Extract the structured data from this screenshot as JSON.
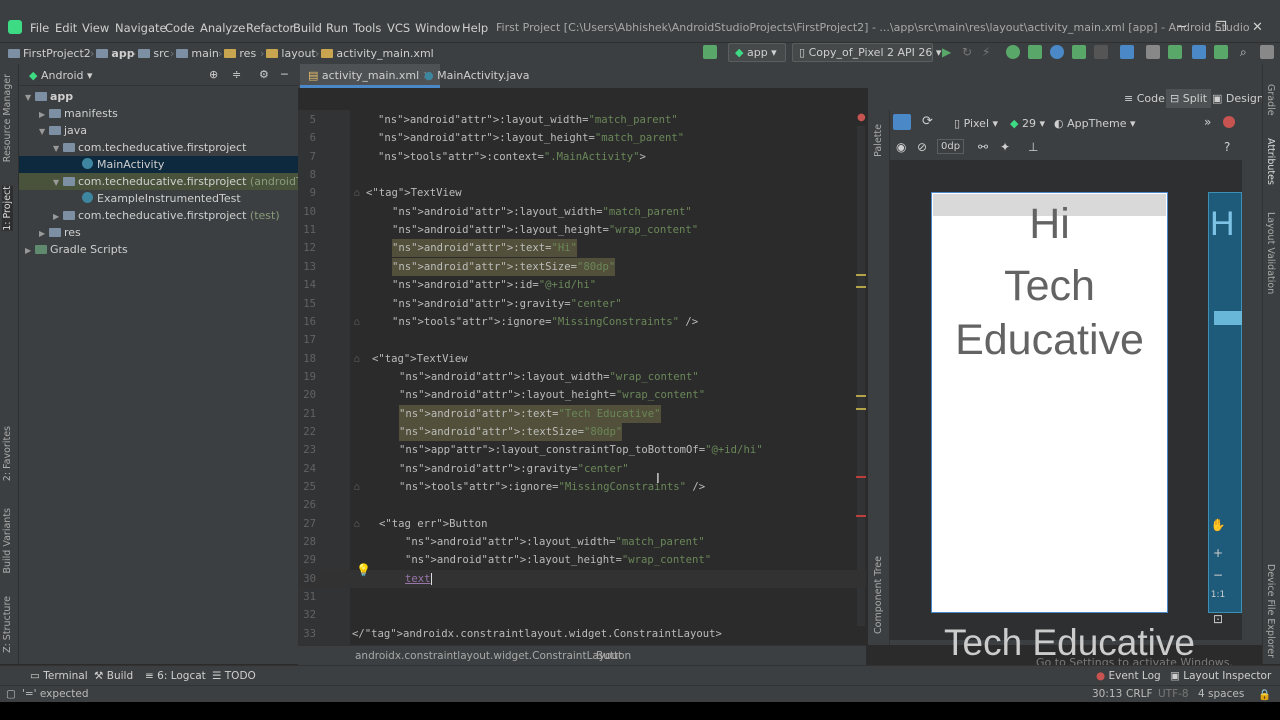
{
  "menu": [
    "File",
    "Edit",
    "View",
    "Navigate",
    "Code",
    "Analyze",
    "Refactor",
    "Build",
    "Run",
    "Tools",
    "VCS",
    "Window",
    "Help"
  ],
  "window_title": "First Project [C:\\Users\\Abhishek\\AndroidStudioProjects\\FirstProject2] - ...\\app\\src\\main\\res\\layout\\activity_main.xml [app] - Android Studio",
  "breadcrumbs": [
    "FirstProject2",
    "app",
    "src",
    "main",
    "res",
    "layout",
    "activity_main.xml"
  ],
  "toolbar": {
    "run_config": "app",
    "device": "Copy_of_Pixel 2 API 26"
  },
  "left_strip": [
    "Resource Manager",
    "1: Project",
    "2: Favorites",
    "Build Variants",
    "Z: Structure"
  ],
  "project": {
    "view_mode": "Android",
    "tree": [
      "app",
      "manifests",
      "java",
      "com.techeducative.firstproject",
      "MainActivity",
      "com.techeducative.firstproject",
      "(androidTest)",
      "ExampleInstrumentedTest",
      "com.techeducative.firstproject",
      "(test)",
      "res",
      "Gradle Scripts"
    ]
  },
  "tabs": [
    "activity_main.xml",
    "MainActivity.java"
  ],
  "view_modes": [
    "Code",
    "Split",
    "Design"
  ],
  "design_toolbar": {
    "device": "Pixel",
    "api": "29",
    "theme": "AppTheme",
    "margin": "0dp"
  },
  "palette_label": "Palette",
  "component_tree_label": "Component Tree",
  "right_strip": [
    "Gradle",
    "Attributes",
    "Layout Validation",
    "Device File Explorer"
  ],
  "code_lines": [
    {
      "n": "5",
      "t": "    android:layout_width=\"match_parent\""
    },
    {
      "n": "6",
      "t": "    android:layout_height=\"match_parent\""
    },
    {
      "n": "7",
      "t": "    tools:context=\".MainActivity\">"
    },
    {
      "n": "8",
      "t": ""
    },
    {
      "n": "9",
      "t": "<TextView"
    },
    {
      "n": "10",
      "t": "    android:layout_width=\"match_parent\""
    },
    {
      "n": "11",
      "t": "    android:layout_height=\"wrap_content\""
    },
    {
      "n": "12",
      "t": "    android:text=\"Hi\""
    },
    {
      "n": "13",
      "t": "    android:textSize=\"80dp\""
    },
    {
      "n": "14",
      "t": "    android:id=\"@+id/hi\""
    },
    {
      "n": "15",
      "t": "    android:gravity=\"center\""
    },
    {
      "n": "16",
      "t": "    tools:ignore=\"MissingConstraints\" />"
    },
    {
      "n": "17",
      "t": ""
    },
    {
      "n": "18",
      "t": "<TextView"
    },
    {
      "n": "19",
      "t": "    android:layout_width=\"wrap_content\""
    },
    {
      "n": "20",
      "t": "    android:layout_height=\"wrap_content\""
    },
    {
      "n": "21",
      "t": "    android:text=\"Tech Educative\""
    },
    {
      "n": "22",
      "t": "    android:textSize=\"80dp\""
    },
    {
      "n": "23",
      "t": "    app:layout_constraintTop_toBottomOf=\"@+id/hi\""
    },
    {
      "n": "24",
      "t": "    android:gravity=\"center\""
    },
    {
      "n": "25",
      "t": "    tools:ignore=\"MissingConstraints\" />"
    },
    {
      "n": "26",
      "t": ""
    },
    {
      "n": "27",
      "t": "<Button"
    },
    {
      "n": "28",
      "t": "    android:layout_width=\"match_parent\""
    },
    {
      "n": "29",
      "t": "    android:layout_height=\"wrap_content\""
    },
    {
      "n": "30",
      "t": "    text"
    },
    {
      "n": "31",
      "t": ""
    },
    {
      "n": "32",
      "t": ""
    },
    {
      "n": "33",
      "t": "</androidx.constraintlayout.widget.ConstraintLayout>"
    }
  ],
  "editor_breadcrumb": [
    "androidx.constraintlayout.widget.ConstraintLayout",
    "Button"
  ],
  "preview": {
    "text1": "Hi",
    "text2a": "Tech",
    "text2b": "Educative",
    "blueprint_text": "H",
    "ghost_text": "Tech Educative",
    "zoom_fit": "1:1"
  },
  "watermark": "Go to Settings to activate Windows.",
  "bottom_tools": [
    "Terminal",
    "Build",
    "6: Logcat",
    "TODO",
    "Event Log",
    "Layout Inspector"
  ],
  "status": {
    "message": "'=' expected",
    "position": "30:13",
    "line_sep": "CRLF",
    "encoding": "UTF-8",
    "indent": "4 spaces"
  }
}
